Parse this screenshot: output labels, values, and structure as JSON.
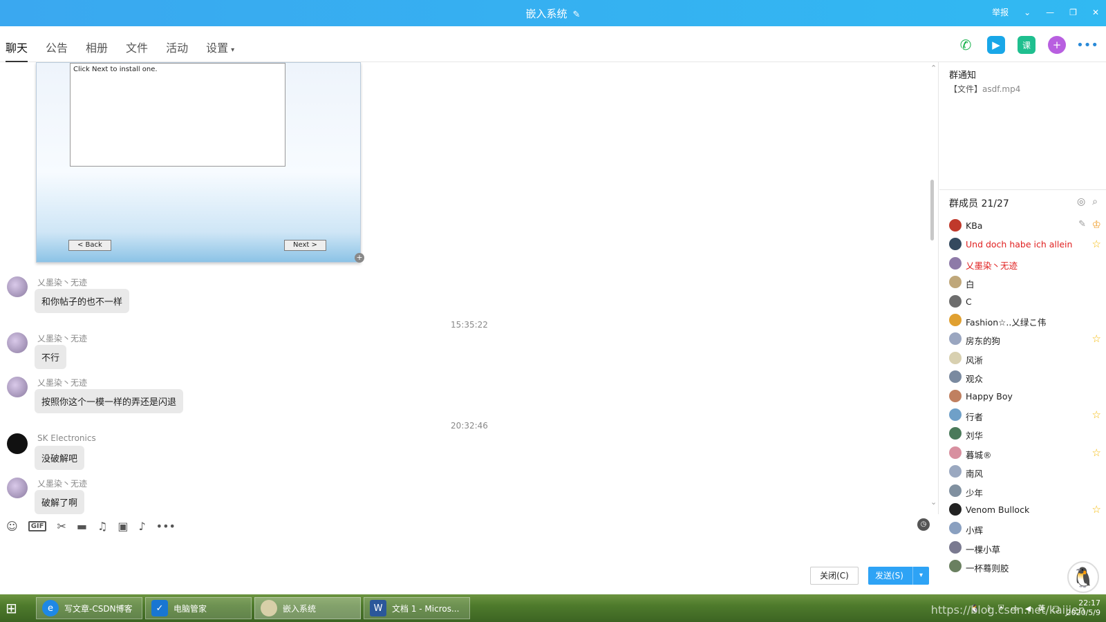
{
  "window": {
    "title": "嵌入系统",
    "report": "举报"
  },
  "tabs": [
    "聊天",
    "公告",
    "相册",
    "文件",
    "活动",
    "设置"
  ],
  "installer": {
    "text": "Click Next to install one.",
    "back": "< Back",
    "next": "Next >"
  },
  "messages": [
    {
      "name": "乂墨染丶无迹",
      "text": "和你帖子的也不一样"
    },
    {
      "name": "乂墨染丶无迹",
      "text": "不行"
    },
    {
      "name": "乂墨染丶无迹",
      "text": "按照你这个一模一样的弄还是闪退"
    },
    {
      "name": "SK  Electronics",
      "text": "没破解吧"
    },
    {
      "name": "乂墨染丶无迹",
      "text": "破解了啊"
    }
  ],
  "timestamps": [
    "15:35:22",
    "20:32:46"
  ],
  "composer": {
    "close": "关闭(C)",
    "send": "发送(S)"
  },
  "notice": {
    "title": "群通知",
    "prefix": "【文件】",
    "file": "asdf.mp4"
  },
  "members": {
    "title": "群成员 21/27",
    "list": [
      {
        "name": "KBa",
        "color": "#222",
        "badge": "owner"
      },
      {
        "name": "Und doch habe ich allein",
        "color": "#e02020",
        "badge": "star"
      },
      {
        "name": "乂墨染丶无迹",
        "color": "#e02020",
        "badge": ""
      },
      {
        "name": "白",
        "color": "#222",
        "badge": ""
      },
      {
        "name": "C",
        "color": "#222",
        "badge": ""
      },
      {
        "name": "Fashion☆..乂绿こ伟",
        "color": "#222",
        "badge": ""
      },
      {
        "name": "房东的狗",
        "color": "#222",
        "badge": "star"
      },
      {
        "name": "风淅",
        "color": "#222",
        "badge": ""
      },
      {
        "name": "观众",
        "color": "#222",
        "badge": ""
      },
      {
        "name": "Happy Boy",
        "color": "#222",
        "badge": ""
      },
      {
        "name": "行者",
        "color": "#222",
        "badge": "star"
      },
      {
        "name": "刘华",
        "color": "#222",
        "badge": ""
      },
      {
        "name": "暮城®",
        "color": "#222",
        "badge": "star"
      },
      {
        "name": "南风",
        "color": "#222",
        "badge": ""
      },
      {
        "name": "少年",
        "color": "#222",
        "badge": ""
      },
      {
        "name": "Venom Bullock",
        "color": "#222",
        "badge": "star"
      },
      {
        "name": "小辉",
        "color": "#222",
        "badge": ""
      },
      {
        "name": "一棵小草",
        "color": "#222",
        "badge": ""
      },
      {
        "name": "一杯蓦则胶",
        "color": "#222",
        "badge": ""
      }
    ]
  },
  "taskbar": {
    "tasks": [
      "写文章-CSDN博客",
      "电脑管家",
      "嵌入系统",
      "文档 1 - Micros..."
    ],
    "ime": "英",
    "time": "22:17",
    "date": "2020/5/9"
  },
  "watermark": "https://blog.csdn.net/kaijien"
}
